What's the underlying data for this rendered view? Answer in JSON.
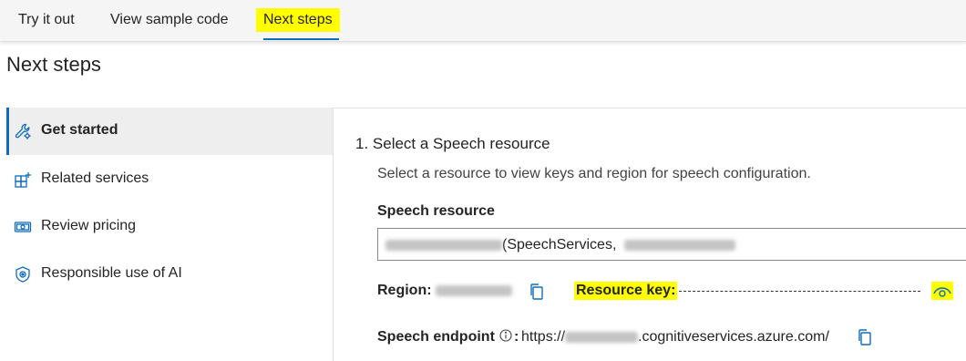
{
  "tabs": [
    {
      "label": "Try it out"
    },
    {
      "label": "View sample code"
    },
    {
      "label": "Next steps",
      "selected": true
    }
  ],
  "page": {
    "title": "Next steps"
  },
  "sidebar": {
    "items": [
      {
        "label": "Get started",
        "icon": "wrench-gear-icon",
        "selected": true
      },
      {
        "label": "Related services",
        "icon": "grid-add-icon"
      },
      {
        "label": "Review pricing",
        "icon": "money-icon"
      },
      {
        "label": "Responsible use of AI",
        "icon": "shield-icon"
      }
    ]
  },
  "section": {
    "heading": "1. Select a Speech resource",
    "description": "Select a resource to view keys and region for speech configuration.",
    "resource_label": "Speech resource",
    "resource_value_visible": "(SpeechServices,",
    "region_label": "Region:",
    "key_label": "Resource key:",
    "endpoint_label": "Speech endpoint",
    "endpoint_prefix": "https://",
    "endpoint_suffix": ".cognitiveservices.azure.com/"
  },
  "colors": {
    "accent": "#0f6cbd",
    "highlight": "#ffff00"
  }
}
